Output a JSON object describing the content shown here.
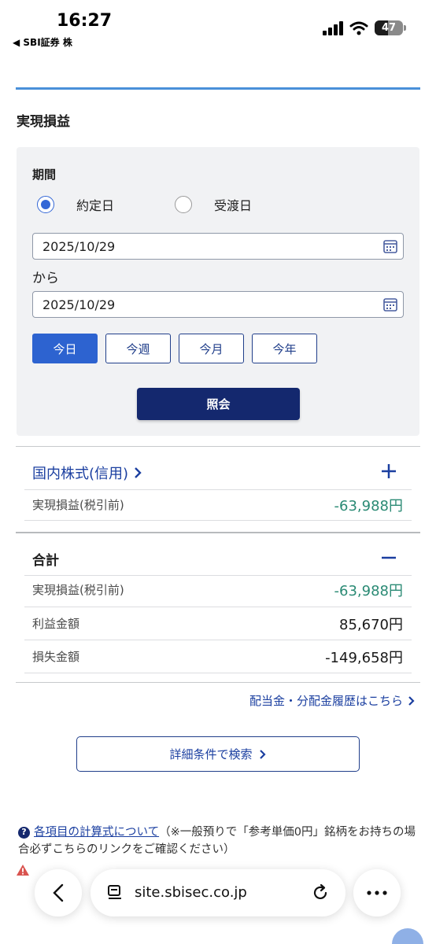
{
  "status_bar": {
    "time": "16:27",
    "back_app": "◀ SBI証券 株",
    "battery": "47",
    "battery_level_percent": 47
  },
  "section_title": "実現損益",
  "filter": {
    "period_label": "期間",
    "radio_options": [
      {
        "label": "約定日",
        "selected": true
      },
      {
        "label": "受渡日",
        "selected": false
      }
    ],
    "from_date": "2025/10/29",
    "between_label": "から",
    "to_date": "2025/10/29",
    "quick_buttons": [
      "今日",
      "今週",
      "今月",
      "今年"
    ],
    "active_quick": "今日",
    "query_label": "照会"
  },
  "domestic": {
    "link_label": "国内株式(信用)",
    "rows": [
      {
        "label": "実現損益(税引前)",
        "value": "-63,988円",
        "negative": true
      }
    ]
  },
  "total": {
    "title": "合計",
    "rows": [
      {
        "label": "実現損益(税引前)",
        "value": "-63,988円",
        "negative": true
      },
      {
        "label": "利益金額",
        "value": "85,670円",
        "negative": false
      },
      {
        "label": "損失金額",
        "value": "-149,658円",
        "negative": false
      }
    ]
  },
  "dividend_link": "配当金・分配金履歴はこちら",
  "detail_search_label": "詳細条件で検索",
  "notes": {
    "calc_link": "各項目の計算式について",
    "calc_text": "（※一般預りで「参考単価0円」銘柄をお持ちの場合必ずこちらのリンクをご確認ください）"
  },
  "browser": {
    "url": "site.sbisec.co.jp"
  },
  "colors": {
    "brand_navy": "#14286e",
    "accent_blue": "#2d63d0",
    "link_blue": "#1b3fa0",
    "loss_green": "#2a8a74",
    "panel_bg": "#f1f2f4"
  }
}
